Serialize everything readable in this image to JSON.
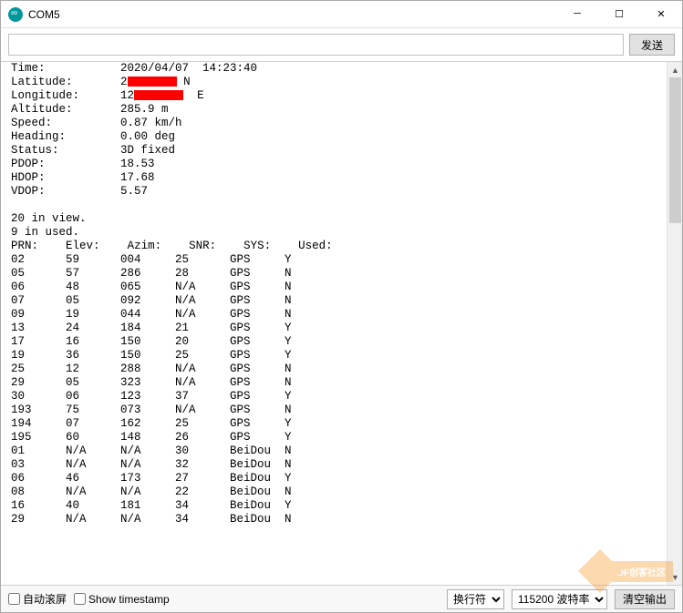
{
  "window": {
    "title": "COM5"
  },
  "input": {
    "value": "",
    "send_label": "发送"
  },
  "summary": {
    "labels": {
      "time": "Time:",
      "lat": "Latitude:",
      "lon": "Longitude:",
      "alt": "Altitude:",
      "speed": "Speed:",
      "heading": "Heading:",
      "status": "Status:",
      "pdop": "PDOP:",
      "hdop": "HDOP:",
      "vdop": "VDOP:"
    },
    "values": {
      "time": "2020/04/07  14:23:40",
      "lat_prefix": "2",
      "lat_suffix": "N",
      "lon_prefix": "12",
      "lon_suffix": "E",
      "alt": "285.9 m",
      "speed": "0.87 km/h",
      "heading": "0.00 deg",
      "status": "3D fixed",
      "pdop": "18.53",
      "hdop": "17.68",
      "vdop": "5.57"
    }
  },
  "view_line": "20 in view.",
  "used_line": "9 in used.",
  "headers": {
    "prn": "PRN:",
    "elev": "Elev:",
    "azim": "Azim:",
    "snr": "SNR:",
    "sys": "SYS:",
    "used": "Used:"
  },
  "sats": [
    {
      "prn": "02",
      "elev": "59",
      "azim": "004",
      "snr": "25",
      "sys": "GPS",
      "used": "Y"
    },
    {
      "prn": "05",
      "elev": "57",
      "azim": "286",
      "snr": "28",
      "sys": "GPS",
      "used": "N"
    },
    {
      "prn": "06",
      "elev": "48",
      "azim": "065",
      "snr": "N/A",
      "sys": "GPS",
      "used": "N"
    },
    {
      "prn": "07",
      "elev": "05",
      "azim": "092",
      "snr": "N/A",
      "sys": "GPS",
      "used": "N"
    },
    {
      "prn": "09",
      "elev": "19",
      "azim": "044",
      "snr": "N/A",
      "sys": "GPS",
      "used": "N"
    },
    {
      "prn": "13",
      "elev": "24",
      "azim": "184",
      "snr": "21",
      "sys": "GPS",
      "used": "Y"
    },
    {
      "prn": "17",
      "elev": "16",
      "azim": "150",
      "snr": "20",
      "sys": "GPS",
      "used": "Y"
    },
    {
      "prn": "19",
      "elev": "36",
      "azim": "150",
      "snr": "25",
      "sys": "GPS",
      "used": "Y"
    },
    {
      "prn": "25",
      "elev": "12",
      "azim": "288",
      "snr": "N/A",
      "sys": "GPS",
      "used": "N"
    },
    {
      "prn": "29",
      "elev": "05",
      "azim": "323",
      "snr": "N/A",
      "sys": "GPS",
      "used": "N"
    },
    {
      "prn": "30",
      "elev": "06",
      "azim": "123",
      "snr": "37",
      "sys": "GPS",
      "used": "Y"
    },
    {
      "prn": "193",
      "elev": "75",
      "azim": "073",
      "snr": "N/A",
      "sys": "GPS",
      "used": "N"
    },
    {
      "prn": "194",
      "elev": "07",
      "azim": "162",
      "snr": "25",
      "sys": "GPS",
      "used": "Y"
    },
    {
      "prn": "195",
      "elev": "60",
      "azim": "148",
      "snr": "26",
      "sys": "GPS",
      "used": "Y"
    },
    {
      "prn": "01",
      "elev": "N/A",
      "azim": "N/A",
      "snr": "30",
      "sys": "BeiDou",
      "used": "N"
    },
    {
      "prn": "03",
      "elev": "N/A",
      "azim": "N/A",
      "snr": "32",
      "sys": "BeiDou",
      "used": "N"
    },
    {
      "prn": "06",
      "elev": "46",
      "azim": "173",
      "snr": "27",
      "sys": "BeiDou",
      "used": "Y"
    },
    {
      "prn": "08",
      "elev": "N/A",
      "azim": "N/A",
      "snr": "22",
      "sys": "BeiDou",
      "used": "N"
    },
    {
      "prn": "16",
      "elev": "40",
      "azim": "181",
      "snr": "34",
      "sys": "BeiDou",
      "used": "Y"
    },
    {
      "prn": "29",
      "elev": "N/A",
      "azim": "N/A",
      "snr": "34",
      "sys": "BeiDou",
      "used": "N"
    }
  ],
  "bottom": {
    "autoscroll": "自动滚屏",
    "timestamp": "Show timestamp",
    "line_ending": "换行符",
    "baud": "115200 波特率",
    "clear": "清空输出"
  },
  "watermark": {
    "text": "DF创客社区"
  }
}
